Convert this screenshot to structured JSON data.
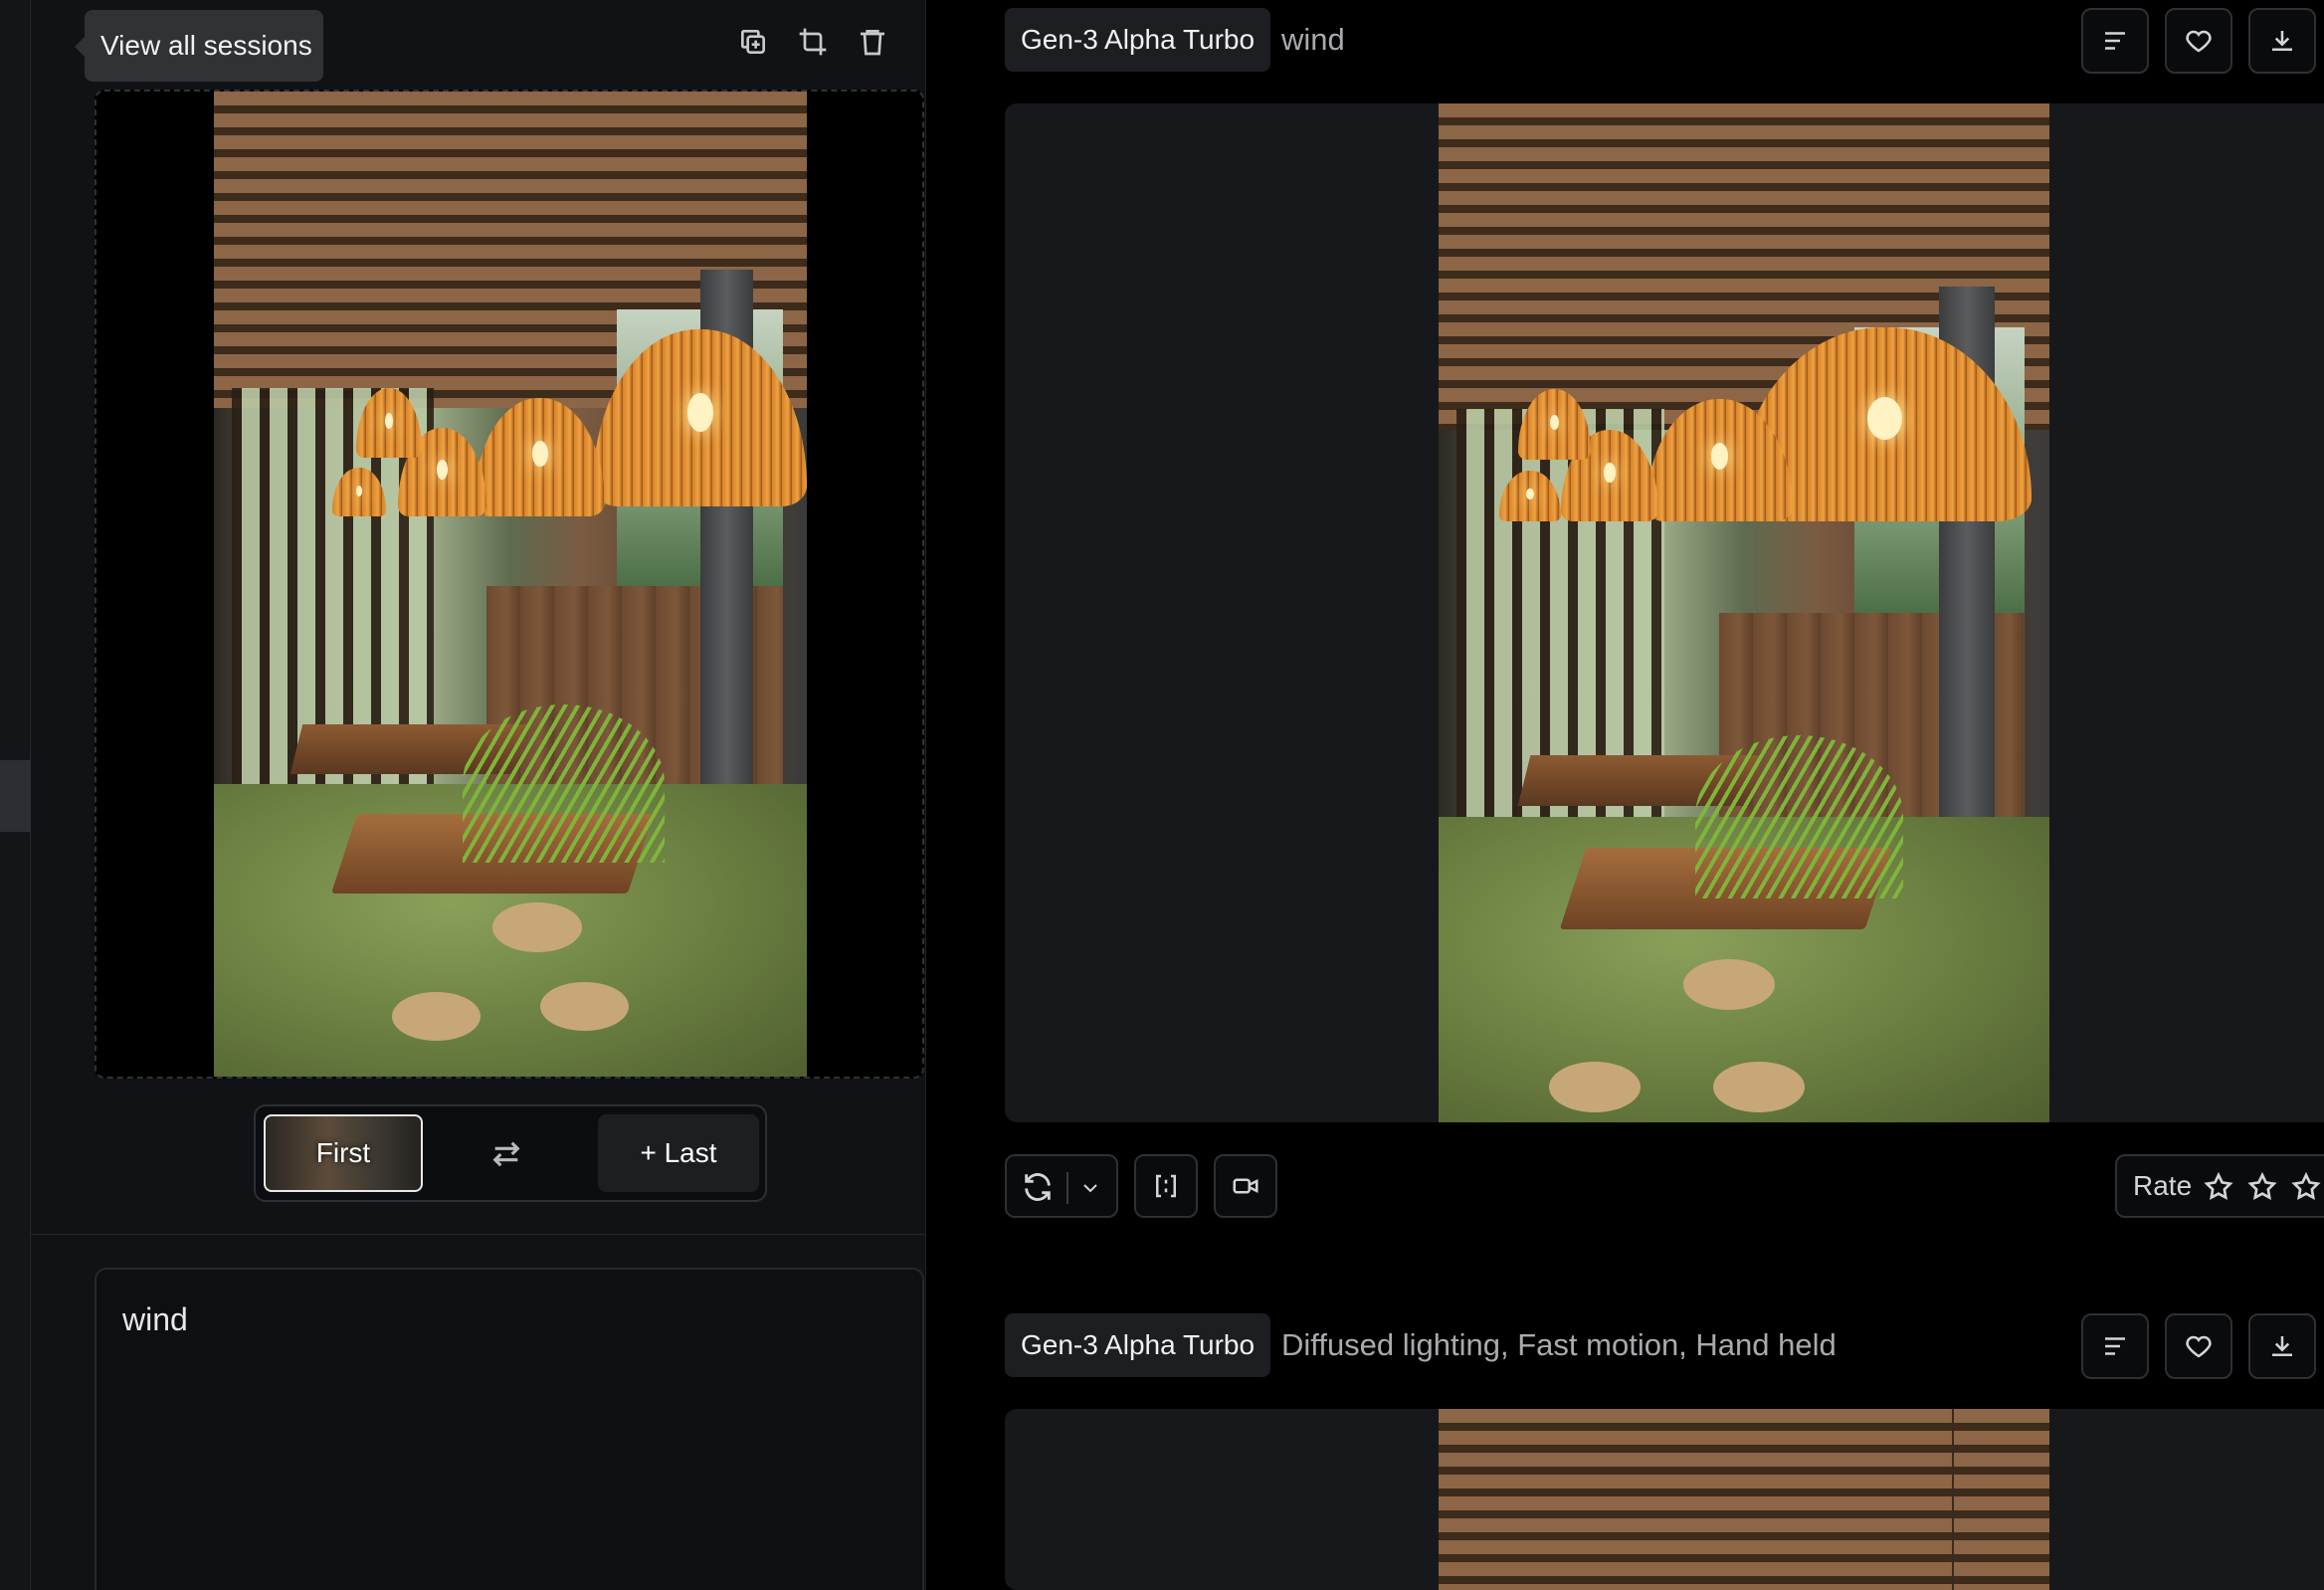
{
  "left_panel": {
    "tooltip": "View all sessions",
    "tools": [
      "copy-icon",
      "crop-icon",
      "trash-icon"
    ],
    "reference_toggle": {
      "first_label": "First",
      "last_label": "+ Last",
      "swap_icon": "swap-arrows-icon"
    },
    "prompt_text": "wind"
  },
  "feed": {
    "generations": [
      {
        "model": "Gen-3 Alpha Turbo",
        "prompt": "wind",
        "header_actions": [
          "details-icon",
          "heart-icon",
          "download-icon"
        ],
        "actions": [
          "refresh-icon",
          "chevron-down-icon",
          "extend-icon",
          "video-camera-icon"
        ],
        "rate_label": "Rate"
      },
      {
        "model": "Gen-3 Alpha Turbo",
        "prompt": "Diffused lighting, Fast motion, Hand held",
        "header_actions": [
          "details-icon",
          "heart-icon",
          "download-icon"
        ]
      }
    ]
  },
  "colors": {
    "background": "#000000",
    "panel": "#111215",
    "card": "#17181c",
    "tag": "#1c1e22",
    "text_muted": "#a9aaae"
  }
}
